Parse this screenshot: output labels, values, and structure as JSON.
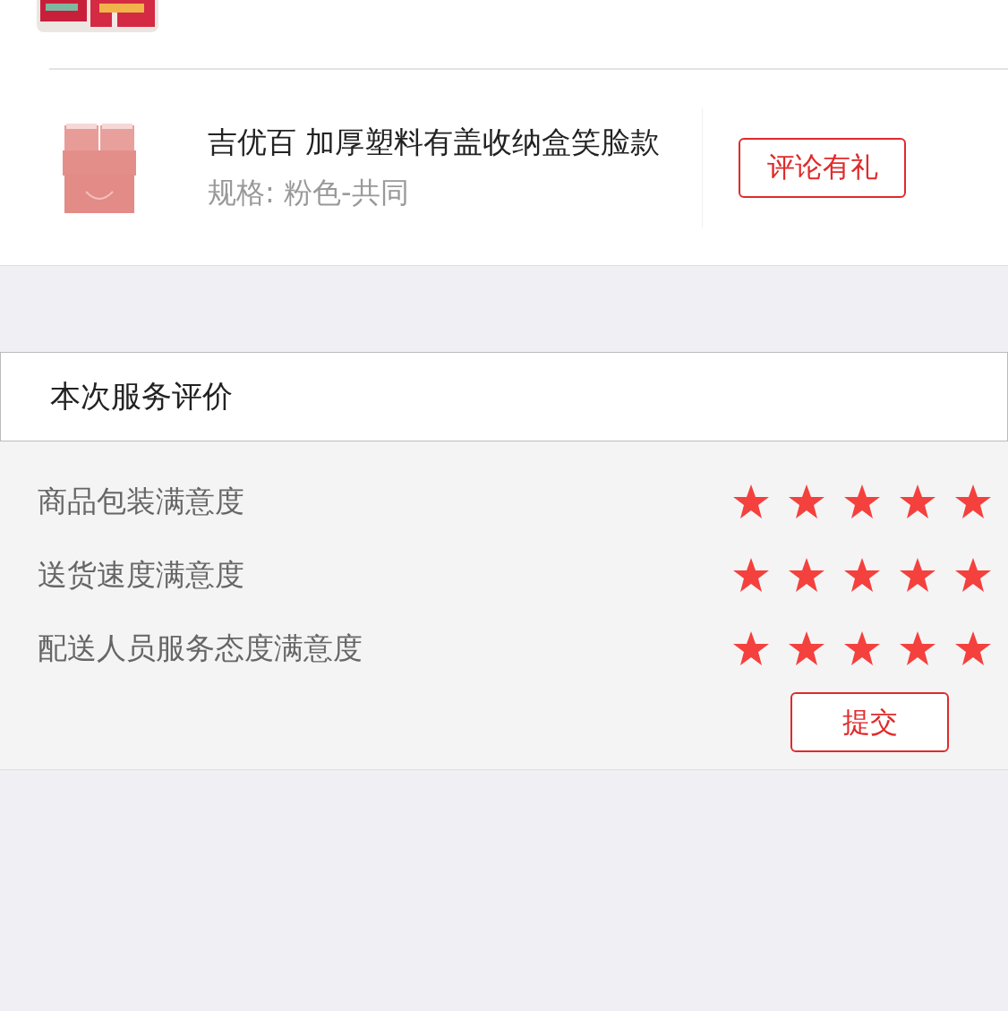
{
  "products": [
    {
      "kind": "partial"
    },
    {
      "kind": "full",
      "title": "吉优百 加厚塑料有盖收纳盒笑脸款",
      "spec": "规格: 粉色-共同",
      "button": "评论有礼"
    }
  ],
  "service": {
    "title": "本次服务评价",
    "ratings": [
      {
        "label": "商品包装满意度",
        "stars": 5
      },
      {
        "label": "送货速度满意度",
        "stars": 5
      },
      {
        "label": "配送人员服务态度满意度",
        "stars": 5
      }
    ],
    "submit": "提交"
  }
}
